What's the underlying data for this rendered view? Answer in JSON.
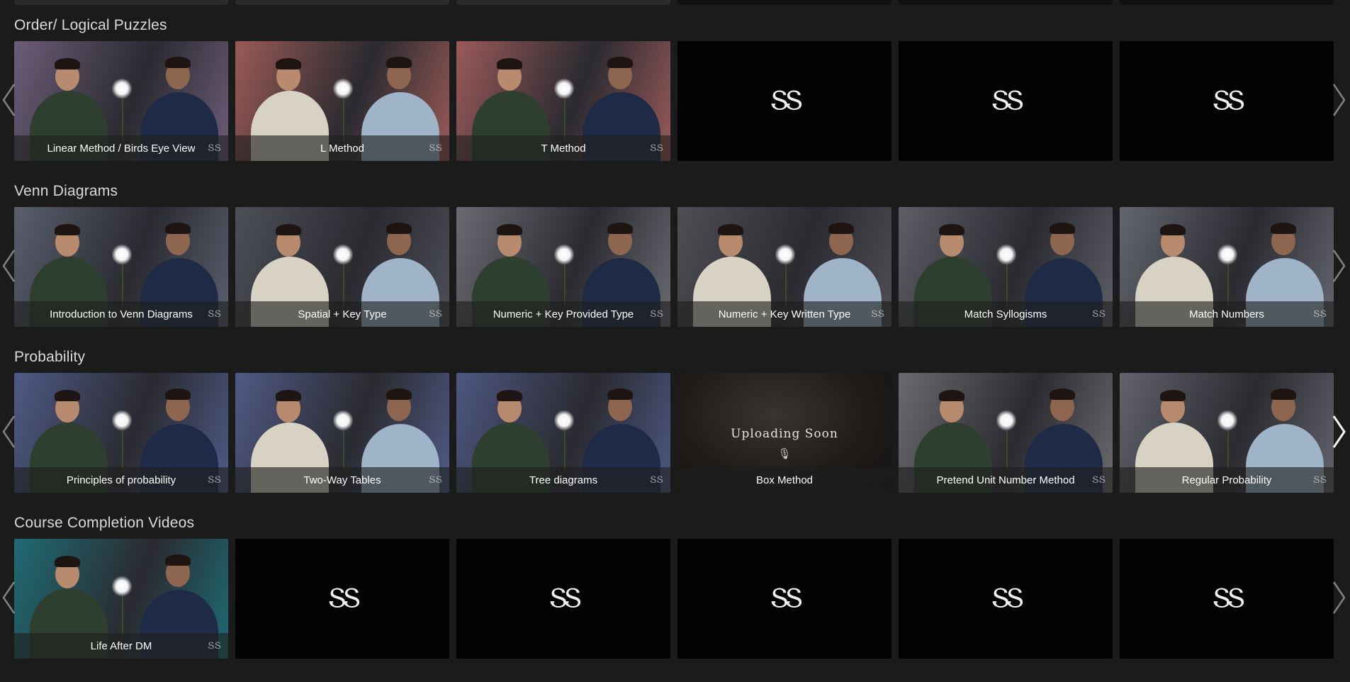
{
  "sections": [
    {
      "title": "Order/ Logical Puzzles",
      "cards": [
        {
          "label": "Linear Method / Birds Eye View",
          "kind": "video",
          "tone": "#6b5d78"
        },
        {
          "label": "L Method",
          "kind": "video",
          "tone": "#9b5a56"
        },
        {
          "label": "T Method",
          "kind": "video",
          "tone": "#9a5a5a"
        },
        {
          "label": "",
          "kind": "blank"
        },
        {
          "label": "",
          "kind": "blank"
        },
        {
          "label": "",
          "kind": "blank"
        }
      ]
    },
    {
      "title": "Venn Diagrams",
      "cards": [
        {
          "label": "Introduction to Venn Diagrams",
          "kind": "video",
          "tone": "#5a5f6e"
        },
        {
          "label": "Spatial + Key Type",
          "kind": "video",
          "tone": "#4d4f57"
        },
        {
          "label": "Numeric + Key Provided Type",
          "kind": "video",
          "tone": "#6a6a72"
        },
        {
          "label": "Numeric + Key Written Type",
          "kind": "video",
          "tone": "#4e4e54"
        },
        {
          "label": "Match Syllogisms",
          "kind": "video",
          "tone": "#5d5e66"
        },
        {
          "label": "Match Numbers",
          "kind": "video",
          "tone": "#64666f"
        }
      ]
    },
    {
      "title": "Probability",
      "cards": [
        {
          "label": "Principles of probability",
          "kind": "video",
          "tone": "#4f5a86"
        },
        {
          "label": "Two-Way Tables",
          "kind": "video",
          "tone": "#505a85"
        },
        {
          "label": "Tree diagrams",
          "kind": "video",
          "tone": "#4d5782"
        },
        {
          "label": "Box Method",
          "kind": "upload",
          "upload_text": "Uploading Soon"
        },
        {
          "label": "Pretend Unit Number Method",
          "kind": "video",
          "tone": "#6b6a6e"
        },
        {
          "label": "Regular Probability",
          "kind": "video",
          "tone": "#62636b"
        }
      ]
    },
    {
      "title": "Course Completion Videos",
      "cards": [
        {
          "label": "Life After DM",
          "kind": "video",
          "tone": "#1f6b74"
        },
        {
          "label": "",
          "kind": "blank"
        },
        {
          "label": "",
          "kind": "blank"
        },
        {
          "label": "",
          "kind": "blank"
        },
        {
          "label": "",
          "kind": "blank"
        },
        {
          "label": "",
          "kind": "blank"
        }
      ]
    }
  ],
  "logo_glyph": "ՏՏ",
  "watermark_glyph": "ՏՏ",
  "icons": {
    "prev": "chevron-left-icon",
    "next": "chevron-right-icon",
    "mic": "microphone-icon"
  },
  "colors": {
    "background": "#1b1b1b",
    "label_bar": "rgba(30,30,30,0.62)",
    "text": "#ffffff"
  }
}
